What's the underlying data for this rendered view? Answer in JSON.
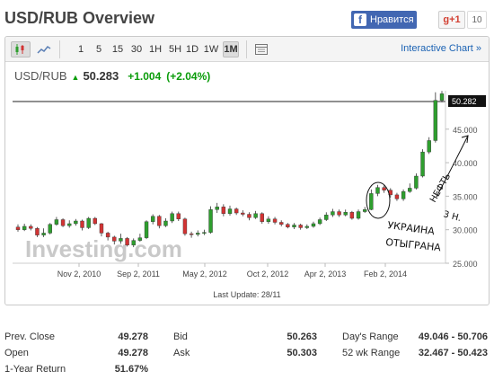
{
  "header": {
    "title": "USD/RUB Overview",
    "fb_label": "Нравится",
    "gplus_label": "g+1",
    "gplus_count": "10"
  },
  "toolbar": {
    "timeframes": [
      "1",
      "5",
      "15",
      "30",
      "1H",
      "5H",
      "1D",
      "1W",
      "1M"
    ],
    "active_timeframe": "1M",
    "interactive_label": "Interactive Chart »"
  },
  "quote": {
    "symbol": "USD/RUB",
    "price": "50.283",
    "change": "+1.004",
    "change_pct": "(+2.04%)"
  },
  "chart_data": {
    "type": "candlestick",
    "x_tick_labels": [
      "Nov 2, 2010",
      "Sep 2, 2011",
      "May 2, 2012",
      "Oct 2, 2012",
      "Apr 2, 2013",
      "Feb 2, 2014"
    ],
    "y_tick_labels": [
      "25.000",
      "30.000",
      "35.000",
      "40.000",
      "45.000",
      "50.282"
    ],
    "ylim": [
      25,
      51
    ],
    "last_price_label": "50.282",
    "footer": "Last Update: 28/11",
    "watermark": "Investing.com",
    "candles": [
      {
        "o": 30.4,
        "c": 30.0,
        "h": 30.8,
        "l": 29.7
      },
      {
        "o": 30.0,
        "c": 30.5,
        "h": 30.9,
        "l": 29.8
      },
      {
        "o": 30.5,
        "c": 30.2,
        "h": 30.8,
        "l": 29.9
      },
      {
        "o": 30.2,
        "c": 29.2,
        "h": 30.4,
        "l": 28.9
      },
      {
        "o": 29.2,
        "c": 29.5,
        "h": 30.2,
        "l": 28.9
      },
      {
        "o": 29.5,
        "c": 30.8,
        "h": 31.0,
        "l": 29.3
      },
      {
        "o": 30.8,
        "c": 31.5,
        "h": 31.9,
        "l": 30.6
      },
      {
        "o": 31.5,
        "c": 30.6,
        "h": 31.7,
        "l": 30.4
      },
      {
        "o": 30.6,
        "c": 30.9,
        "h": 31.4,
        "l": 30.3
      },
      {
        "o": 30.9,
        "c": 31.3,
        "h": 31.6,
        "l": 30.6
      },
      {
        "o": 31.3,
        "c": 30.3,
        "h": 31.5,
        "l": 29.9
      },
      {
        "o": 30.3,
        "c": 31.7,
        "h": 31.9,
        "l": 30.1
      },
      {
        "o": 31.7,
        "c": 30.9,
        "h": 31.9,
        "l": 30.7
      },
      {
        "o": 30.9,
        "c": 29.5,
        "h": 31.0,
        "l": 29.0
      },
      {
        "o": 29.5,
        "c": 28.9,
        "h": 29.7,
        "l": 28.4
      },
      {
        "o": 28.9,
        "c": 28.3,
        "h": 29.1,
        "l": 27.8
      },
      {
        "o": 28.3,
        "c": 28.7,
        "h": 29.4,
        "l": 27.9
      },
      {
        "o": 28.7,
        "c": 27.7,
        "h": 28.9,
        "l": 27.5
      },
      {
        "o": 27.7,
        "c": 28.4,
        "h": 28.7,
        "l": 27.4
      },
      {
        "o": 28.4,
        "c": 28.8,
        "h": 29.4,
        "l": 28.2
      },
      {
        "o": 28.8,
        "c": 31.2,
        "h": 31.4,
        "l": 28.6
      },
      {
        "o": 31.2,
        "c": 32.0,
        "h": 32.3,
        "l": 30.8
      },
      {
        "o": 32.0,
        "c": 30.6,
        "h": 32.2,
        "l": 30.2
      },
      {
        "o": 30.6,
        "c": 31.3,
        "h": 31.7,
        "l": 30.4
      },
      {
        "o": 31.3,
        "c": 32.4,
        "h": 32.7,
        "l": 31.0
      },
      {
        "o": 32.4,
        "c": 31.6,
        "h": 32.7,
        "l": 31.3
      },
      {
        "o": 31.6,
        "c": 29.4,
        "h": 31.8,
        "l": 29.1
      },
      {
        "o": 29.4,
        "c": 29.3,
        "h": 29.7,
        "l": 28.8
      },
      {
        "o": 29.3,
        "c": 29.5,
        "h": 29.9,
        "l": 29.0
      },
      {
        "o": 29.5,
        "c": 29.6,
        "h": 30.0,
        "l": 29.2
      },
      {
        "o": 29.6,
        "c": 33.0,
        "h": 33.5,
        "l": 29.4
      },
      {
        "o": 33.0,
        "c": 33.4,
        "h": 34.0,
        "l": 32.5
      },
      {
        "o": 33.4,
        "c": 32.4,
        "h": 33.8,
        "l": 32.0
      },
      {
        "o": 32.4,
        "c": 33.1,
        "h": 33.6,
        "l": 32.1
      },
      {
        "o": 33.1,
        "c": 32.5,
        "h": 33.3,
        "l": 32.2
      },
      {
        "o": 32.5,
        "c": 32.3,
        "h": 32.9,
        "l": 32.0
      },
      {
        "o": 32.3,
        "c": 31.8,
        "h": 32.6,
        "l": 31.4
      },
      {
        "o": 31.8,
        "c": 32.4,
        "h": 32.8,
        "l": 31.6
      },
      {
        "o": 32.4,
        "c": 31.2,
        "h": 32.6,
        "l": 30.9
      },
      {
        "o": 31.2,
        "c": 31.6,
        "h": 32.0,
        "l": 30.9
      },
      {
        "o": 31.6,
        "c": 31.1,
        "h": 31.9,
        "l": 30.8
      },
      {
        "o": 31.1,
        "c": 30.8,
        "h": 31.4,
        "l": 30.5
      },
      {
        "o": 30.8,
        "c": 30.4,
        "h": 31.0,
        "l": 30.2
      },
      {
        "o": 30.4,
        "c": 30.7,
        "h": 31.0,
        "l": 30.1
      },
      {
        "o": 30.7,
        "c": 30.3,
        "h": 30.9,
        "l": 30.0
      },
      {
        "o": 30.3,
        "c": 30.5,
        "h": 30.8,
        "l": 30.1
      },
      {
        "o": 30.5,
        "c": 30.9,
        "h": 31.2,
        "l": 30.3
      },
      {
        "o": 30.9,
        "c": 31.5,
        "h": 31.8,
        "l": 30.7
      },
      {
        "o": 31.5,
        "c": 32.2,
        "h": 32.6,
        "l": 31.3
      },
      {
        "o": 32.2,
        "c": 32.7,
        "h": 33.1,
        "l": 31.9
      },
      {
        "o": 32.7,
        "c": 32.2,
        "h": 33.0,
        "l": 31.9
      },
      {
        "o": 32.2,
        "c": 32.6,
        "h": 33.0,
        "l": 32.0
      },
      {
        "o": 32.6,
        "c": 31.7,
        "h": 32.8,
        "l": 31.5
      },
      {
        "o": 31.7,
        "c": 32.7,
        "h": 33.0,
        "l": 31.5
      },
      {
        "o": 32.7,
        "c": 33.0,
        "h": 33.4,
        "l": 32.5
      },
      {
        "o": 33.0,
        "c": 35.4,
        "h": 36.0,
        "l": 32.9
      },
      {
        "o": 35.4,
        "c": 36.3,
        "h": 36.7,
        "l": 35.0
      },
      {
        "o": 36.3,
        "c": 35.9,
        "h": 36.6,
        "l": 35.5
      },
      {
        "o": 35.9,
        "c": 35.2,
        "h": 36.2,
        "l": 34.8
      },
      {
        "o": 35.2,
        "c": 34.6,
        "h": 35.5,
        "l": 34.3
      },
      {
        "o": 34.6,
        "c": 35.7,
        "h": 36.0,
        "l": 34.3
      },
      {
        "o": 35.7,
        "c": 36.2,
        "h": 36.9,
        "l": 35.5
      },
      {
        "o": 36.2,
        "c": 38.0,
        "h": 38.4,
        "l": 36.0
      },
      {
        "o": 38.0,
        "c": 41.6,
        "h": 42.0,
        "l": 37.8
      },
      {
        "o": 41.6,
        "c": 43.3,
        "h": 43.8,
        "l": 41.3
      },
      {
        "o": 43.3,
        "c": 49.3,
        "h": 50.5,
        "l": 43.0
      },
      {
        "o": 49.3,
        "c": 50.28,
        "h": 50.7,
        "l": 49.0
      }
    ]
  },
  "stats": {
    "prev_close_label": "Prev. Close",
    "prev_close": "49.278",
    "open_label": "Open",
    "open": "49.278",
    "year_return_label": "1-Year Return",
    "year_return": "51.67%",
    "bid_label": "Bid",
    "bid": "50.263",
    "ask_label": "Ask",
    "ask": "50.303",
    "days_range_label": "Day's Range",
    "days_range": "49.046 - 50.706",
    "wk52_range_label": "52 wk Range",
    "wk52_range": "32.467 - 50.423"
  },
  "annotations": {
    "line1": "УКРАИНА",
    "line2": "ОТЫГРАНА",
    "line3": "3 Н.",
    "line4": "НЕФТЬ"
  },
  "colors": {
    "up": "#2e9e2e",
    "down": "#d23333",
    "link": "#1b62b3",
    "positive": "#0a9c0a"
  }
}
